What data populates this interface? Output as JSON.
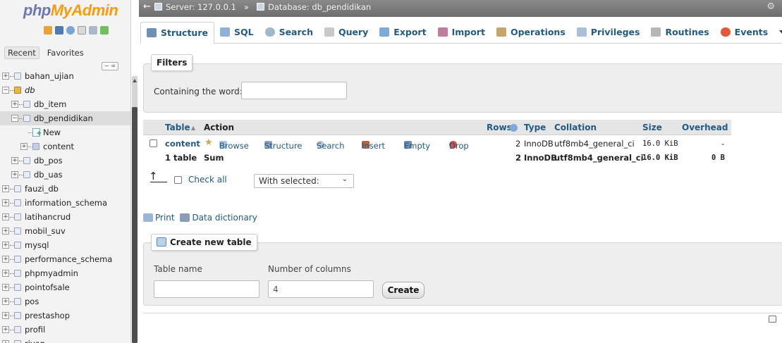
{
  "logo": {
    "part1": "php",
    "part2": "MyAdmin"
  },
  "nav_tabs": [
    "Recent",
    "Favorites"
  ],
  "tree": [
    {
      "label": "bahan_ujian",
      "indent": 0,
      "expand": "+"
    },
    {
      "label": "db",
      "indent": 0,
      "expand": "−"
    },
    {
      "label": "db_item",
      "indent": 1,
      "expand": "+"
    },
    {
      "label": "db_pendidikan",
      "indent": 1,
      "expand": "−"
    },
    {
      "label": "New",
      "indent": 2,
      "expand": ""
    },
    {
      "label": "content",
      "indent": 2,
      "expand": "+"
    },
    {
      "label": "db_pos",
      "indent": 1,
      "expand": "+"
    },
    {
      "label": "db_uas",
      "indent": 1,
      "expand": "+"
    },
    {
      "label": "fauzi_db",
      "indent": 0,
      "expand": "+"
    },
    {
      "label": "information_schema",
      "indent": 0,
      "expand": "+"
    },
    {
      "label": "latihancrud",
      "indent": 0,
      "expand": "+"
    },
    {
      "label": "mobil_suv",
      "indent": 0,
      "expand": "+"
    },
    {
      "label": "mysql",
      "indent": 0,
      "expand": "+"
    },
    {
      "label": "performance_schema",
      "indent": 0,
      "expand": "+"
    },
    {
      "label": "phpmyadmin",
      "indent": 0,
      "expand": "+"
    },
    {
      "label": "pointofsale",
      "indent": 0,
      "expand": "+"
    },
    {
      "label": "pos",
      "indent": 0,
      "expand": "+"
    },
    {
      "label": "prestashop",
      "indent": 0,
      "expand": "+"
    },
    {
      "label": "profil",
      "indent": 0,
      "expand": "+"
    },
    {
      "label": "rivan",
      "indent": 0,
      "expand": "+"
    }
  ],
  "breadcrumb": {
    "server": "Server: 127.0.0.1",
    "sep": "»",
    "database": "Database: db_pendidikan"
  },
  "tabs": [
    {
      "label": "Structure",
      "icon": "structure-icon",
      "color": "#6f8fb5"
    },
    {
      "label": "SQL",
      "icon": "sql-icon",
      "color": "#8fb1d6"
    },
    {
      "label": "Search",
      "icon": "search-icon",
      "color": "#9fb7cf"
    },
    {
      "label": "Query",
      "icon": "query-icon",
      "color": "#c9c9c9"
    },
    {
      "label": "Export",
      "icon": "export-icon",
      "color": "#7ea9d8"
    },
    {
      "label": "Import",
      "icon": "import-icon",
      "color": "#c07c9c"
    },
    {
      "label": "Operations",
      "icon": "wrench-icon",
      "color": "#c7a46a"
    },
    {
      "label": "Privileges",
      "icon": "privileges-icon",
      "color": "#a8c0dc"
    },
    {
      "label": "Routines",
      "icon": "routines-icon",
      "color": "#b6b6b6"
    },
    {
      "label": "Events",
      "icon": "clock-icon",
      "color": "#e05a3a"
    },
    {
      "label": "More",
      "icon": "caret-down-icon",
      "color": "#333333"
    }
  ],
  "filters": {
    "legend": "Filters",
    "label": "Containing the word:",
    "value": ""
  },
  "table": {
    "headers": {
      "table": "Table",
      "sort": "▲",
      "action": "Action",
      "rows": "Rows",
      "type": "Type",
      "collation": "Collation",
      "size": "Size",
      "overhead": "Overhead"
    },
    "row": {
      "name": "content",
      "actions": [
        "Browse",
        "Structure",
        "Search",
        "Insert",
        "Empty",
        "Drop"
      ],
      "rows": "2",
      "type": "InnoDB",
      "collation": "utf8mb4_general_ci",
      "size": "16.0 KiB",
      "overhead": "-"
    },
    "sum": {
      "tables": "1 table",
      "label": "Sum",
      "rows": "2",
      "type": "InnoDB",
      "collation": "utf8mb4_general_ci",
      "size": "16.0 KiB",
      "overhead": "0 B"
    }
  },
  "checkall_label": "Check all",
  "with_selected": "With selected:",
  "print_label": "Print",
  "dictionary_label": "Data dictionary",
  "create": {
    "legend": "Create new table",
    "table_name_label": "Table name",
    "columns_label": "Number of columns",
    "table_name_value": "",
    "columns_value": "4",
    "button": "Create"
  }
}
